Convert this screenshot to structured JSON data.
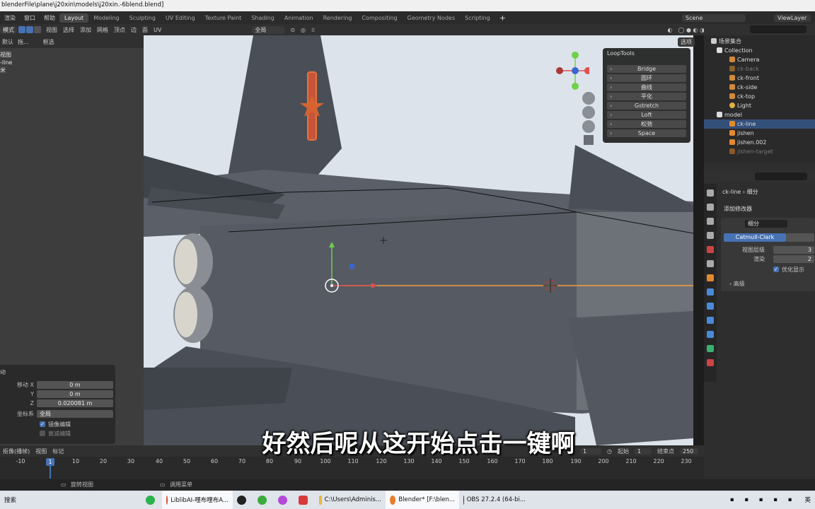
{
  "window": {
    "title": "blenderFile\\plane\\j20xin\\models\\j20xin.-6blend.blend]"
  },
  "menu": {
    "items": [
      "渲染",
      "窗口",
      "帮助"
    ]
  },
  "workspaces": [
    "Layout",
    "Modeling",
    "Sculpting",
    "UV Editing",
    "Texture Paint",
    "Shading",
    "Animation",
    "Rendering",
    "Compositing",
    "Geometry Nodes",
    "Scripting"
  ],
  "workspace_add": "+",
  "scene": {
    "label": "Scene",
    "view_layer": "ViewLayer"
  },
  "header": {
    "mode": "模式",
    "menus": [
      "视图",
      "选择",
      "添加",
      "网格",
      "顶点",
      "边",
      "面",
      "UV"
    ],
    "transform": "全局",
    "options": "选项"
  },
  "left": {
    "header_items": [
      "默认",
      "拖...",
      "框选"
    ],
    "list": [
      "视图",
      "-line",
      "米"
    ]
  },
  "operator": {
    "title": "动",
    "move_label": "移动 X",
    "x": "0 m",
    "y_label": "Y",
    "y": "0 m",
    "z_label": "Z",
    "z": "0.020081 m",
    "coord_label": "坐标系",
    "coord_value": "全局",
    "mirror_edit": "镜像编辑",
    "decay_edit": "衰减编辑"
  },
  "looptools": {
    "title": "LoopTools",
    "items": [
      "Bridge",
      "圆环",
      "曲线",
      "平化",
      "Gstretch",
      "Loft",
      "松弛",
      "Space"
    ]
  },
  "outliner": {
    "title": "场景集合",
    "rows": [
      {
        "label": "Collection",
        "level": 1
      },
      {
        "label": "Camera",
        "level": 2
      },
      {
        "label": "ck-back",
        "level": 2,
        "dim": true
      },
      {
        "label": "ck-front",
        "level": 2
      },
      {
        "label": "ck-side",
        "level": 2
      },
      {
        "label": "ck-top",
        "level": 2
      },
      {
        "label": "Light",
        "level": 2
      },
      {
        "label": "model",
        "level": 1
      },
      {
        "label": "ck-line",
        "level": 2,
        "highlight": true
      },
      {
        "label": "jishen",
        "level": 2
      },
      {
        "label": "jishen.002",
        "level": 2
      },
      {
        "label": "jishen-target",
        "level": 2,
        "dim": true
      }
    ]
  },
  "properties": {
    "object": "ck-line",
    "modifier_crumb": "细分",
    "add_modifier": "添加修改器",
    "modifier_name": "细分",
    "catmull": "Catmull-Clark",
    "levels_label": "视图层级",
    "levels": "3",
    "render_label": "渲染",
    "render": "2",
    "optimal": "优化显示",
    "advanced": "高级"
  },
  "timeline": {
    "menus": [
      "抠像(播帧)",
      "视图",
      "标记"
    ],
    "current_frame": "1",
    "start_label": "起始",
    "start": "1",
    "end_label": "结束点",
    "end": "250",
    "ticks": [
      "-10",
      "1",
      "10",
      "20",
      "30",
      "40",
      "50",
      "60",
      "70",
      "80",
      "90",
      "100",
      "110",
      "120",
      "130",
      "140",
      "150",
      "160",
      "170",
      "180",
      "190",
      "200",
      "210",
      "220",
      "230"
    ]
  },
  "status": {
    "rotate": "旋转视图",
    "menu": "调用菜单"
  },
  "taskbar": {
    "search": "搜索",
    "apps": [
      "LiblibAI-哩布哩布A...",
      "C:\\Users\\Adminis...",
      "Blender* [F:\\blen...",
      "OBS 27.2.4 (64-bi..."
    ],
    "lang": "英"
  },
  "subtitle": "好然后呢从这开始点击一键啊",
  "colors": {
    "accent": "#4772b3",
    "selected": "#33507a",
    "viewport_bg": "#dde3ea"
  }
}
